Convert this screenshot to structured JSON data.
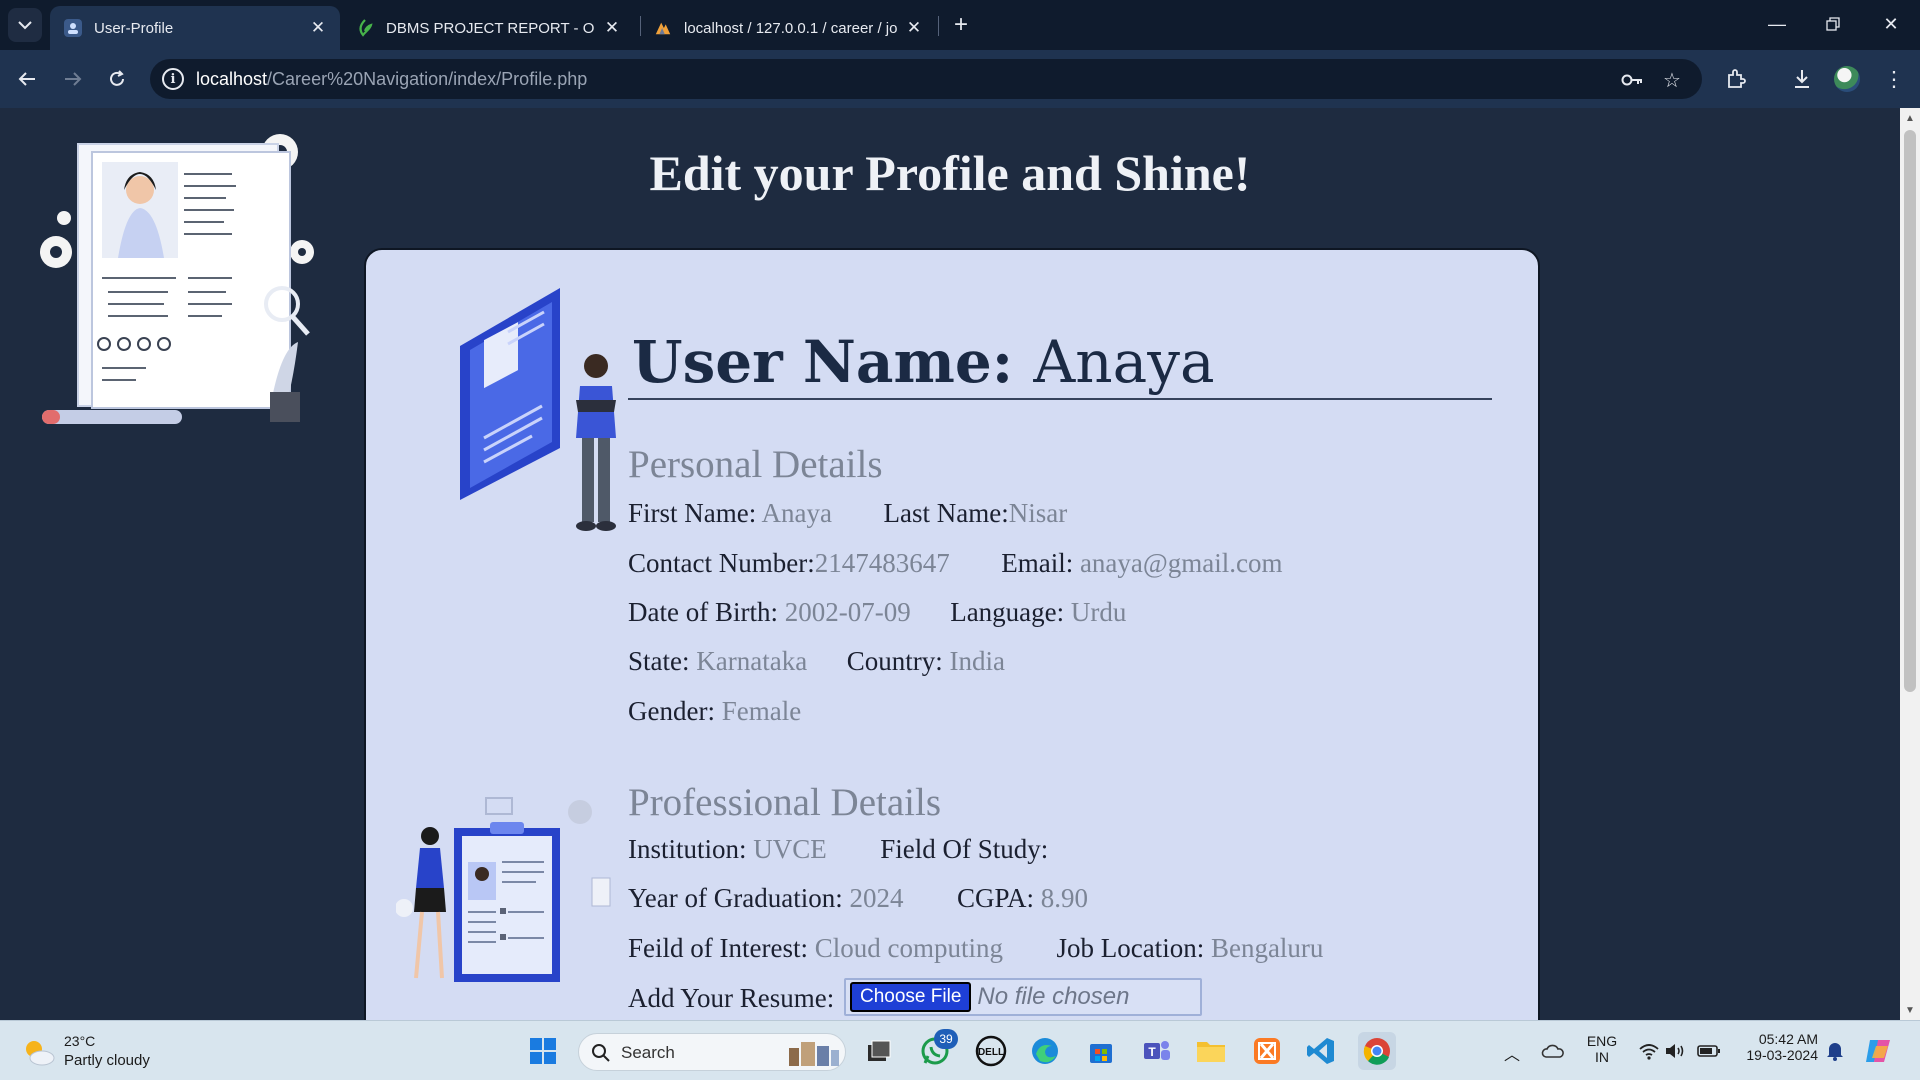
{
  "browser": {
    "tabs": [
      {
        "title": "User-Profile",
        "active": true
      },
      {
        "title": "DBMS PROJECT REPORT - Online",
        "active": false
      },
      {
        "title": "localhost / 127.0.0.1 / career / jo",
        "active": false
      }
    ],
    "url_host": "localhost",
    "url_path": "/Career%20Navigation/index/Profile.php"
  },
  "page": {
    "heading": "Edit your Profile and Shine!",
    "username_label": "User Name:",
    "username_value": "Anaya",
    "personal": {
      "title": "Personal Details",
      "first_name_label": "First Name:",
      "first_name": "Anaya",
      "last_name_label": "Last Name:",
      "last_name": "Nisar",
      "contact_label": "Contact Number:",
      "contact": "2147483647",
      "email_label": "Email:",
      "email": "anaya@gmail.com",
      "dob_label": "Date of Birth:",
      "dob": "2002-07-09",
      "language_label": "Language:",
      "language": "Urdu",
      "state_label": "State:",
      "state": "Karnataka",
      "country_label": "Country:",
      "country": "India",
      "gender_label": "Gender:",
      "gender": "Female"
    },
    "professional": {
      "title": "Professional Details",
      "institution_label": "Institution:",
      "institution": "UVCE",
      "field_label": "Field Of Study:",
      "field": "",
      "year_label": "Year of Graduation:",
      "year": "2024",
      "cgpa_label": "CGPA:",
      "cgpa": "8.90",
      "interest_label": "Feild of Interest:",
      "interest": "Cloud computing",
      "location_label": "Job Location:",
      "location": "Bengaluru",
      "resume_label": "Add Your Resume:",
      "choose_file": "Choose File",
      "no_file": "No file chosen"
    }
  },
  "taskbar": {
    "temperature": "23°C",
    "condition": "Partly cloudy",
    "search_placeholder": "Search",
    "whatsapp_badge": "39",
    "lang_line1": "ENG",
    "lang_line2": "IN",
    "time": "05:42 AM",
    "date": "19-03-2024"
  },
  "colors": {
    "page_bg": "#1e2b40",
    "card_bg": "#d4dcf3",
    "accent": "#1e3fd6"
  }
}
